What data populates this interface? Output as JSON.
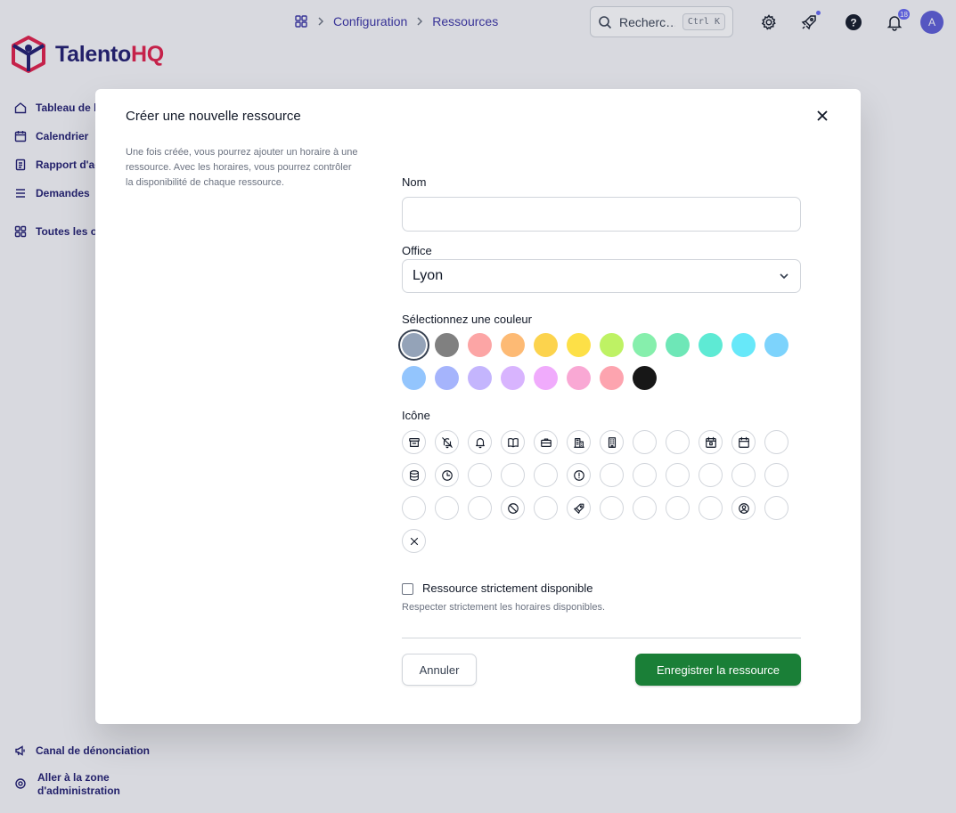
{
  "breadcrumb": {
    "items": [
      "Configuration",
      "Ressources"
    ]
  },
  "search": {
    "placeholder": "Recherc…",
    "shortcut": "Ctrl K"
  },
  "header": {
    "notifications_count": "18",
    "avatar_initial": "A"
  },
  "brand": {
    "name_part1": "Talento",
    "name_part2": "HQ"
  },
  "sidebar": {
    "items": [
      {
        "label": "Tableau de b",
        "icon": "home-icon"
      },
      {
        "label": "Calendrier",
        "icon": "calendar-icon"
      },
      {
        "label": "Rapport d'ac",
        "icon": "report-icon"
      },
      {
        "label": "Demandes",
        "icon": "list-icon"
      },
      {
        "label": "Toutes les o",
        "icon": "grid-icon"
      }
    ],
    "footer": [
      {
        "label": "Canal de dénonciation",
        "icon": "megaphone-icon"
      },
      {
        "label": "Aller à la zone d'administration",
        "icon": "gear-icon"
      }
    ]
  },
  "modal": {
    "title": "Créer une nouvelle ressource",
    "description": "Une fois créée, vous pourrez ajouter un horaire à une ressource. Avec les horaires, vous pourrez contrôler la disponibilité de chaque ressource.",
    "name_label": "Nom",
    "name_value": "",
    "office_label": "Office",
    "office_value": "Lyon",
    "color_label": "Sélectionnez une couleur",
    "colors": [
      "#94a3b8",
      "#808080",
      "#fca5a5",
      "#fdba74",
      "#fcd34d",
      "#fde047",
      "#bef264",
      "#86efac",
      "#6ee7b7",
      "#5eead4",
      "#67e8f9",
      "#7dd3fc",
      "#93c5fd",
      "#a5b4fc",
      "#c4b5fd",
      "#d8b4fe",
      "#f0abfc",
      "#f9a8d4",
      "#fda4af",
      "#171717"
    ],
    "selected_color": "#94a3b8",
    "icon_label": "Icône",
    "icons": [
      "archive-icon",
      "bell-off-icon",
      "bell-icon",
      "book-open-icon",
      "briefcase-icon",
      "building-icon",
      "office-building-icon",
      "",
      "",
      "calendar-event-icon",
      "calendar-icon",
      "",
      "database-icon",
      "clock-icon",
      "",
      "",
      "",
      "alert-circle-icon",
      "",
      "",
      "",
      "",
      "",
      "",
      "",
      "",
      "",
      "ban-icon",
      "",
      "rocket-icon",
      "",
      "",
      "",
      "",
      "user-circle-icon",
      "",
      "x-icon"
    ],
    "strict_label": "Ressource strictement disponible",
    "strict_help": "Respecter strictement les horaires disponibles.",
    "cancel_label": "Annuler",
    "save_label": "Enregistrer la ressource"
  }
}
